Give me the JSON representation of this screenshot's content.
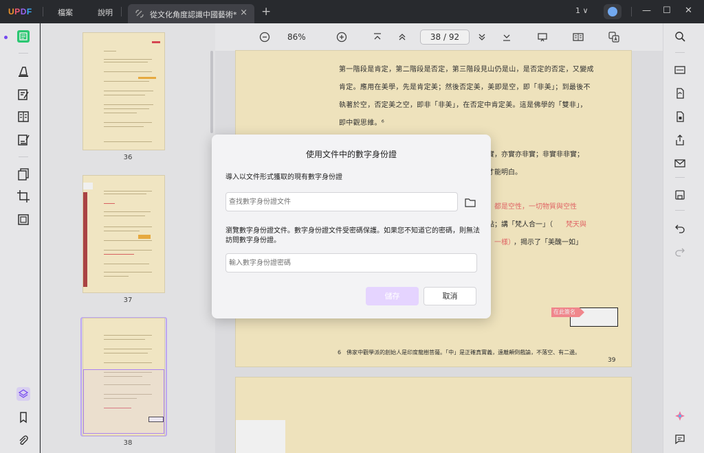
{
  "app": {
    "logo": "UPDF"
  },
  "titlebar": {
    "menu": [
      "檔案",
      "說明"
    ],
    "tab": {
      "label": "從文化角度認識中國藝術*"
    },
    "window_count": "1 ∨"
  },
  "toolbar": {
    "zoom": "86%",
    "page_current": "38",
    "page_total": "92",
    "page_display": "38 / 92"
  },
  "thumbnails": [
    {
      "label": "36"
    },
    {
      "label": "37"
    },
    {
      "label": "38"
    }
  ],
  "document": {
    "lines": [
      "第一階段是肯定，第二階段是否定，第三階段見山仍是山，是否定的否定，又變成",
      "肯定。應用在美學，先是肯定美；然後否定美，美即是空，即「非美」；到最後不",
      "執著於空，否定美之空，即非「非美」，在否定中肯定美。這是佛學的「雙非」，",
      "即中觀思維。⁶"
    ],
    "fragments": [
      {
        "text": "實，亦實亦非實；非實非非實；",
        "color": "dark"
      },
      {
        "text": "才能明白。",
        "color": "dark"
      },
      {
        "text": "都是空性，一切物質與空性",
        "color": "red"
      },
      {
        "text": "點；講「梵人合一」（",
        "color": "dark"
      },
      {
        "text": "梵天與",
        "color": "red"
      },
      {
        "text": "一樣）",
        "color": "red"
      },
      {
        "text": "，揭示了「美醜一如」",
        "color": "dark"
      }
    ],
    "footnote": "6　佛家中觀學派的創始人是印度龍樹菩薩。「中」是正確真實義，遠離顛倒戲論，不落空、有二邊。",
    "page_number": "39",
    "stamp": "在此簽名"
  },
  "dialog": {
    "title": "使用文件中的數字身份證",
    "import_label": "導入以文件形式獲取的現有數字身份證",
    "file_placeholder": "查找數字身份證文件",
    "password_label": "瀏覽數字身份證文件。數字身份證文件受密碼保護。如果您不知道它的密碼，則無法訪問數字身份證。",
    "password_placeholder": "輸入數字身份證密碼",
    "save_label": "儲存",
    "cancel_label": "取消"
  },
  "colors": {
    "accent": "#7c4dff",
    "page_bg": "#fdf1c8",
    "save_disabled": "#e5d4ff",
    "stamp": "#ff8f95",
    "red_text": "#e9605f"
  }
}
